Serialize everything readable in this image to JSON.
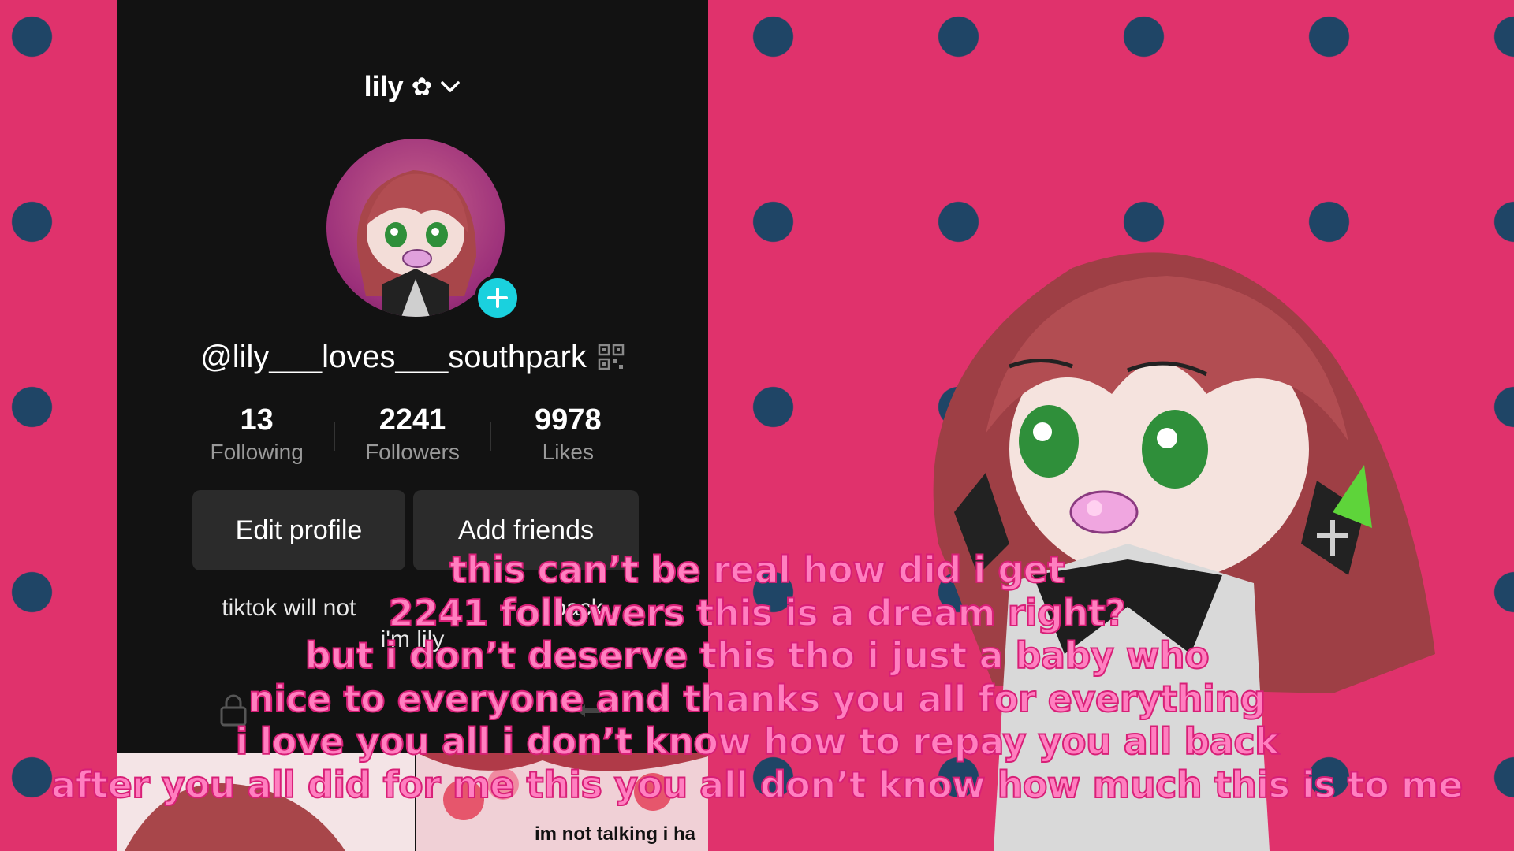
{
  "profile": {
    "display_name": "lily",
    "name_icon": "✿",
    "username": "@lily___loves___southpark",
    "stats": [
      {
        "value": "13",
        "label": "Following"
      },
      {
        "value": "2241",
        "label": "Followers"
      },
      {
        "value": "9978",
        "label": "Likes"
      }
    ],
    "edit_button": "Edit profile",
    "add_friends_button": "Add friends",
    "bio_line1": "tiktok will not",
    "bio_line1_end": "back",
    "bio_line2": "i'm lily",
    "thumb_caption": "im not talking i ha"
  },
  "subtitles": [
    "this can’t be real how did i get",
    "2241 followers this is a dream right?",
    "but i don’t deserve this tho i just a baby who",
    "nice to everyone and thanks you all for everything",
    "i love you all i don’t know how to repay you all back",
    "after you all did for me this you all don’t know how much this is to me"
  ],
  "colors": {
    "background": "#e0326c",
    "dots": "#1f4566",
    "app_bg": "#121212",
    "button_bg": "#2b2b2b",
    "add_badge": "#1ad1de",
    "subtitle_fill": "#ff7fc0",
    "subtitle_stroke": "#d81f77"
  },
  "icons": [
    "flower-icon",
    "chevron-down-icon",
    "plus-icon",
    "qr-code-icon",
    "lock-icon",
    "repost-icon"
  ]
}
